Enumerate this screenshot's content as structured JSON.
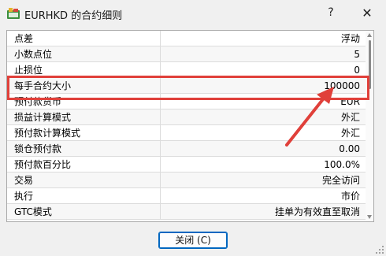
{
  "window": {
    "title": "EURHKD 的合约细则",
    "help_glyph": "?",
    "close_glyph": "✕"
  },
  "specs": [
    {
      "label": "点差",
      "value": "浮动"
    },
    {
      "label": "小数点位",
      "value": "5"
    },
    {
      "label": "止损位",
      "value": "0"
    },
    {
      "label": "每手合约大小",
      "value": "100000"
    },
    {
      "label": "预付款货币",
      "value": "EUR"
    },
    {
      "label": "损益计算模式",
      "value": "外汇"
    },
    {
      "label": "预付款计算模式",
      "value": "外汇"
    },
    {
      "label": "锁仓预付款",
      "value": "0.00"
    },
    {
      "label": "预付款百分比",
      "value": "100.0%"
    },
    {
      "label": "交易",
      "value": "完全访问"
    },
    {
      "label": "执行",
      "value": "市价"
    },
    {
      "label": "GTC模式",
      "value": "挂单为有效直至取消"
    }
  ],
  "footer": {
    "close_button_label": "关闭 (C)"
  },
  "annotation": {
    "highlight_color": "#e0403a"
  }
}
